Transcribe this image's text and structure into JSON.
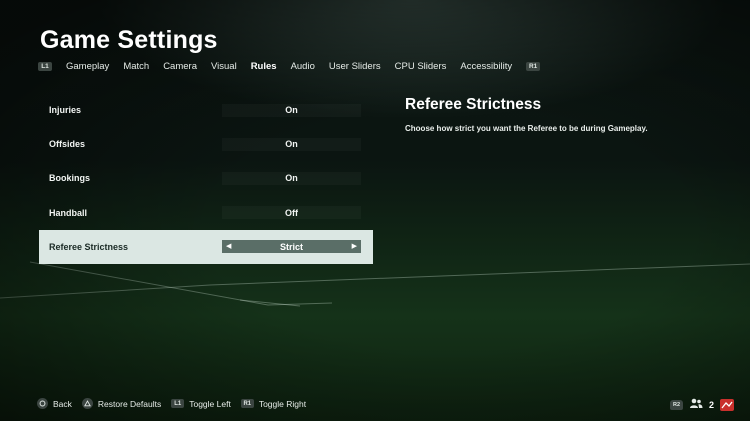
{
  "header": {
    "title": "Game Settings",
    "left_shoulder": "L1",
    "right_shoulder": "R1",
    "tabs": [
      {
        "label": "Gameplay"
      },
      {
        "label": "Match"
      },
      {
        "label": "Camera"
      },
      {
        "label": "Visual"
      },
      {
        "label": "Rules",
        "active": true
      },
      {
        "label": "Audio"
      },
      {
        "label": "User Sliders"
      },
      {
        "label": "CPU Sliders"
      },
      {
        "label": "Accessibility"
      }
    ]
  },
  "settings": [
    {
      "label": "Injuries",
      "value": "On"
    },
    {
      "label": "Offsides",
      "value": "On"
    },
    {
      "label": "Bookings",
      "value": "On"
    },
    {
      "label": "Handball",
      "value": "Off"
    },
    {
      "label": "Referee Strictness",
      "value": "Strict",
      "selected": true
    }
  ],
  "description": {
    "title": "Referee Strictness",
    "text": "Choose how strict you want the Referee to be during Gameplay."
  },
  "footer": {
    "back": "Back",
    "restore_defaults": "Restore Defaults",
    "toggle_left_button": "L1",
    "toggle_left": "Toggle Left",
    "toggle_right_button": "R1",
    "toggle_right": "Toggle Right"
  },
  "corner": {
    "r2_label": "R2",
    "friends_count": "2"
  },
  "colors": {
    "selected_row_bg": "#dbe7e3",
    "selected_value_bg": "#5a6e67",
    "button_glyph_bg": "#3b4541",
    "alert_icon": "#c9302c"
  }
}
